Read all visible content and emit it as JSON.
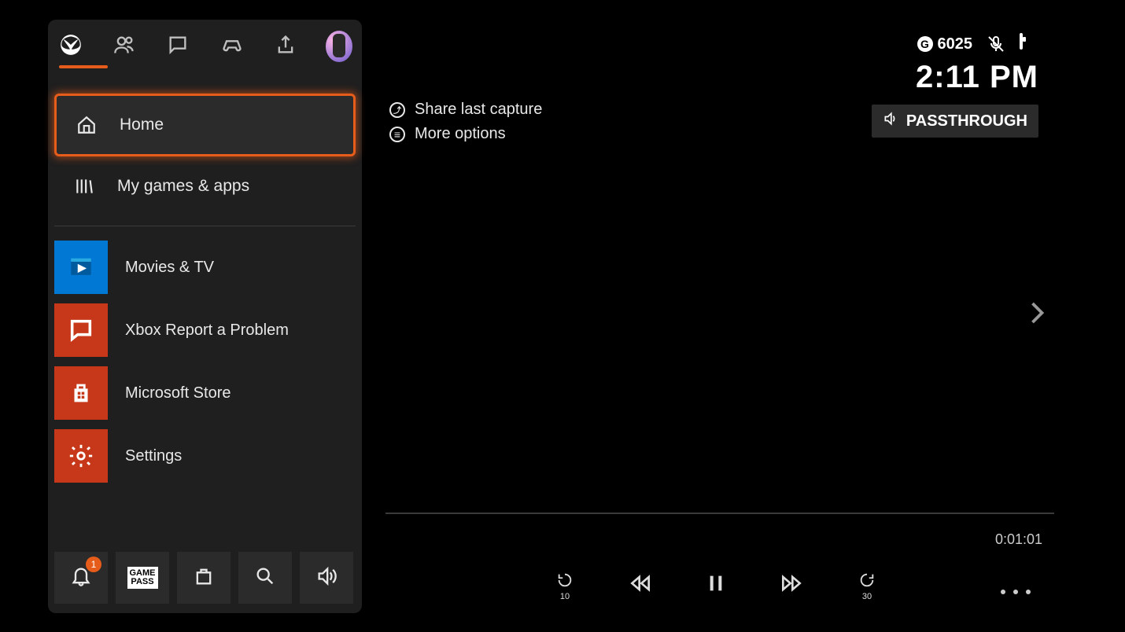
{
  "status": {
    "gamerscore": "6025",
    "clock": "2:11 PM",
    "audio_mode": "PASSTHROUGH"
  },
  "guide": {
    "tabs": {
      "active_index": 0
    },
    "nav": {
      "home": "Home",
      "games": "My games & apps"
    },
    "apps": [
      {
        "label": "Movies & TV",
        "tile": "movies"
      },
      {
        "label": "Xbox Report a Problem",
        "tile": "report"
      },
      {
        "label": "Microsoft Store",
        "tile": "store"
      },
      {
        "label": "Settings",
        "tile": "settings"
      }
    ],
    "footer": {
      "notifications_badge": "1",
      "gamepass_label": "GAME\nPASS"
    }
  },
  "context": {
    "share_capture": "Share last capture",
    "more_options": "More options"
  },
  "playback": {
    "rewind_amount": "10",
    "forward_amount": "30",
    "duration": "0:01:01"
  }
}
